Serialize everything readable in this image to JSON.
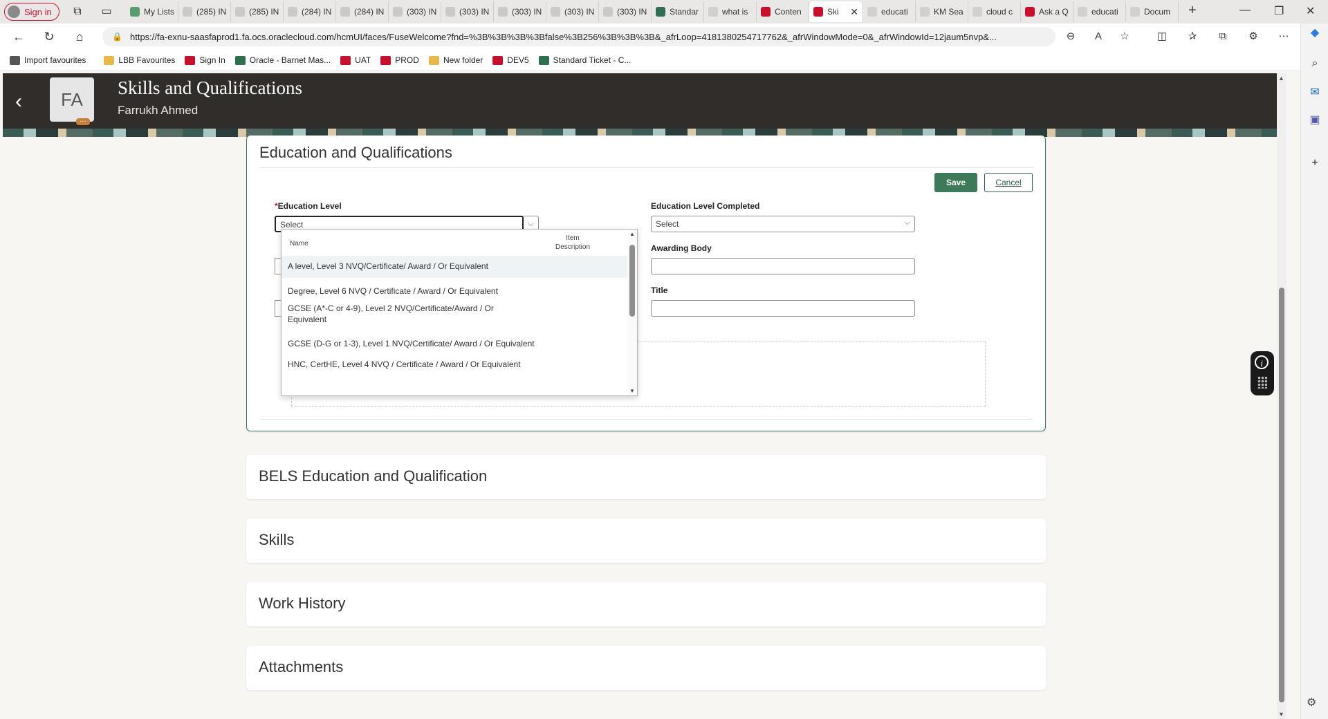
{
  "browser": {
    "profile_label": "Sign in",
    "tabs": [
      {
        "label": "My Lists",
        "color": "#5a9c6f"
      },
      {
        "label": "(285) IN",
        "color": "#c9c9c9"
      },
      {
        "label": "(285) IN",
        "color": "#c9c9c9"
      },
      {
        "label": "(284) IN",
        "color": "#c9c9c9"
      },
      {
        "label": "(284) IN",
        "color": "#c9c9c9"
      },
      {
        "label": "(303) IN",
        "color": "#c9c9c9"
      },
      {
        "label": "(303) IN",
        "color": "#c9c9c9"
      },
      {
        "label": "(303) IN",
        "color": "#c9c9c9"
      },
      {
        "label": "(303) IN",
        "color": "#c9c9c9"
      },
      {
        "label": "(303) IN",
        "color": "#c9c9c9"
      },
      {
        "label": "Standar",
        "color": "#2f6f4f"
      },
      {
        "label": "what is",
        "color": "#d0d0d0"
      },
      {
        "label": "Conten",
        "color": "#c8102e"
      },
      {
        "label": "Ski",
        "color": "#c8102e",
        "active": true
      },
      {
        "label": "educati",
        "color": "#d0d0d0"
      },
      {
        "label": "KM Sea",
        "color": "#d0d0d0"
      },
      {
        "label": "cloud c",
        "color": "#d0d0d0"
      },
      {
        "label": "Ask a Q",
        "color": "#c8102e"
      },
      {
        "label": "educati",
        "color": "#d0d0d0"
      },
      {
        "label": "Docum",
        "color": "#d0d0d0"
      }
    ],
    "url": "https://fa-exnu-saasfaprod1.fa.ocs.oraclecloud.com/hcmUI/faces/FuseWelcome?fnd=%3B%3B%3B%3Bfalse%3B256%3B%3B%3B&_afrLoop=4181380254717762&_afrWindowMode=0&_afrWindowId=12jaum5nvp&...",
    "favourites": [
      {
        "label": "Import favourites",
        "color": "#555555"
      },
      {
        "label": "LBB Favourites",
        "color": "#e8b84a"
      },
      {
        "label": "Sign In",
        "color": "#c8102e"
      },
      {
        "label": "Oracle - Barnet Mas...",
        "color": "#2f6f4f"
      },
      {
        "label": "UAT",
        "color": "#c8102e"
      },
      {
        "label": "PROD",
        "color": "#c8102e"
      },
      {
        "label": "New folder",
        "color": "#e8b84a"
      },
      {
        "label": "DEV5",
        "color": "#c8102e"
      },
      {
        "label": "Standard Ticket - C...",
        "color": "#2f6f4f"
      }
    ]
  },
  "header": {
    "back_icon": "chevron-left-icon",
    "initials": "FA",
    "title": "Skills and Qualifications",
    "subtitle": "Farrukh Ahmed"
  },
  "education": {
    "section_title": "Education and Qualifications",
    "save_label": "Save",
    "cancel_label": "Cancel",
    "education_level": {
      "label": "Education Level",
      "placeholder": "Select"
    },
    "education_level_completed": {
      "label": "Education Level Completed",
      "placeholder": "Select"
    },
    "awarding_body": {
      "label": "Awarding Body",
      "value": ""
    },
    "title_field": {
      "label": "Title",
      "value": ""
    },
    "dropdown": {
      "col_name": "Name",
      "col_desc": "Item Description",
      "options": [
        "A level, Level 3 NVQ/Certificate/ Award / Or Equivalent",
        "Degree, Level 6 NVQ / Certificate / Award / Or Equivalent",
        "GCSE (A*-C or 4-9), Level 2 NVQ/Certificate/Award / Or Equivalent",
        "GCSE (D-G or 1-3), Level 1 NVQ/Certificate/ Award / Or Equivalent",
        "HNC, CertHE, Level 4 NVQ / Certificate / Award / Or Equivalent"
      ]
    }
  },
  "sections": {
    "bels": "BELS Education and Qualification",
    "skills": "Skills",
    "work_history": "Work History",
    "attachments": "Attachments"
  },
  "colors": {
    "accent": "#3d7a5a",
    "header_bg": "#312d2a",
    "required": "#c8102e"
  }
}
